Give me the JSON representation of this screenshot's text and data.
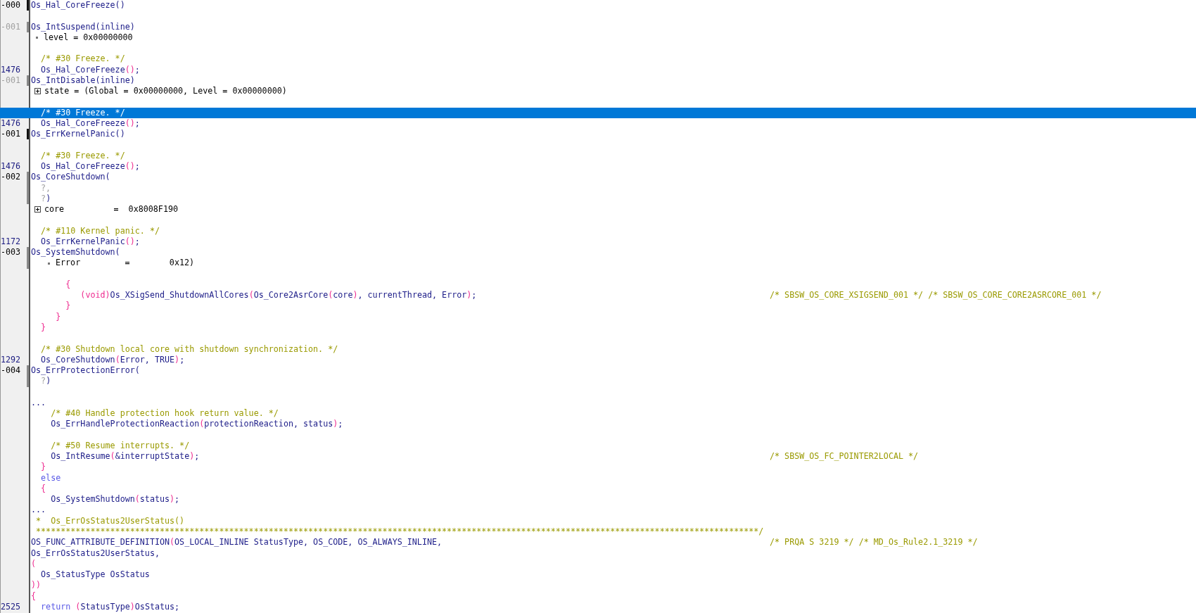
{
  "lines": [
    {
      "selected": false,
      "num": {
        "text": "-000",
        "kind": "frame"
      },
      "marker": {
        "current": true
      },
      "parts": [
        {
          "kind": "fn",
          "text": "Os_Hal_CoreFreeze()"
        }
      ]
    },
    {
      "selected": false
    },
    {
      "selected": false,
      "num": {
        "text": "-001",
        "kind": "inline"
      },
      "marker": {
        "current": false
      },
      "parts": [
        {
          "kind": "fn",
          "text": "Os_IntSuspend(inline)"
        }
      ]
    },
    {
      "selected": false,
      "expander": {
        "kind": "dot",
        "nested": false
      },
      "parts": [
        {
          "kind": "plain",
          "text": "level = 0x00000000"
        }
      ]
    },
    {
      "selected": false
    },
    {
      "selected": false,
      "parts": [
        {
          "kind": "comment",
          "text": "  /* #30 Freeze. */"
        }
      ]
    },
    {
      "selected": false,
      "num": {
        "text": "1476",
        "kind": "source"
      },
      "parts": [
        {
          "kind": "fn",
          "text": "  Os_Hal_CoreFreeze"
        },
        {
          "kind": "punct",
          "text": "()"
        },
        {
          "kind": "fn",
          "text": ";"
        }
      ]
    },
    {
      "selected": false,
      "num": {
        "text": "-001",
        "kind": "inline"
      },
      "marker": {
        "current": false
      },
      "parts": [
        {
          "kind": "fn",
          "text": "Os_IntDisable(inline)"
        }
      ]
    },
    {
      "selected": false,
      "expander": {
        "kind": "plus",
        "nested": false
      },
      "parts": [
        {
          "kind": "plain",
          "text": "state = (Global = 0x00000000, Level = 0x00000000)"
        }
      ]
    },
    {
      "selected": false
    },
    {
      "selected": true,
      "parts": [
        {
          "kind": "comment",
          "text": "  /* #30 Freeze. */"
        }
      ]
    },
    {
      "selected": false,
      "num": {
        "text": "1476",
        "kind": "source"
      },
      "parts": [
        {
          "kind": "fn",
          "text": "  Os_Hal_CoreFreeze"
        },
        {
          "kind": "punct",
          "text": "()"
        },
        {
          "kind": "fn",
          "text": ";"
        }
      ]
    },
    {
      "selected": false,
      "num": {
        "text": "-001",
        "kind": "frame"
      },
      "marker": {
        "current": true
      },
      "parts": [
        {
          "kind": "fn",
          "text": "Os_ErrKernelPanic()"
        }
      ]
    },
    {
      "selected": false
    },
    {
      "selected": false,
      "parts": [
        {
          "kind": "comment",
          "text": "  /* #30 Freeze. */"
        }
      ]
    },
    {
      "selected": false,
      "num": {
        "text": "1476",
        "kind": "source"
      },
      "parts": [
        {
          "kind": "fn",
          "text": "  Os_Hal_CoreFreeze"
        },
        {
          "kind": "punct",
          "text": "()"
        },
        {
          "kind": "fn",
          "text": ";"
        }
      ]
    },
    {
      "selected": false,
      "num": {
        "text": "-002",
        "kind": "frame"
      },
      "marker": {
        "current": false
      },
      "parts": [
        {
          "kind": "fn",
          "text": "Os_CoreShutdown("
        }
      ]
    },
    {
      "selected": false,
      "marker": {
        "current": false
      },
      "parts": [
        {
          "kind": "unknown",
          "text": "  ?,"
        }
      ]
    },
    {
      "selected": false,
      "marker": {
        "current": false
      },
      "parts": [
        {
          "kind": "unknown",
          "text": "  ?"
        },
        {
          "kind": "fn",
          "text": ")"
        }
      ]
    },
    {
      "selected": false,
      "expander": {
        "kind": "plus",
        "nested": false
      },
      "parts": [
        {
          "kind": "plain",
          "text": "core          =  0x8008F190"
        }
      ]
    },
    {
      "selected": false
    },
    {
      "selected": false,
      "parts": [
        {
          "kind": "comment",
          "text": "  /* #110 Kernel panic. */"
        }
      ]
    },
    {
      "selected": false,
      "num": {
        "text": "1172",
        "kind": "source"
      },
      "parts": [
        {
          "kind": "fn",
          "text": "  Os_ErrKernelPanic"
        },
        {
          "kind": "punct",
          "text": "()"
        },
        {
          "kind": "fn",
          "text": ";"
        }
      ]
    },
    {
      "selected": false,
      "num": {
        "text": "-003",
        "kind": "frame"
      },
      "marker": {
        "current": false
      },
      "parts": [
        {
          "kind": "fn",
          "text": "Os_SystemShutdown("
        }
      ]
    },
    {
      "selected": false,
      "marker": {
        "current": false
      },
      "expander": {
        "kind": "dot",
        "nested": true
      },
      "parts": [
        {
          "kind": "plain",
          "text": "Error         =        0x12)"
        }
      ]
    },
    {
      "selected": false
    },
    {
      "selected": false,
      "parts": [
        {
          "kind": "punct",
          "text": "       {"
        }
      ]
    },
    {
      "selected": false,
      "parts": [
        {
          "kind": "punct",
          "text": "          (void)"
        },
        {
          "kind": "fn",
          "text": "Os_XSigSend_ShutdownAllCores"
        },
        {
          "kind": "punct",
          "text": "("
        },
        {
          "kind": "fn",
          "text": "Os_Core2AsrCore"
        },
        {
          "kind": "punct",
          "text": "("
        },
        {
          "kind": "fn",
          "text": "core"
        },
        {
          "kind": "punct",
          "text": ")"
        },
        {
          "kind": "fn",
          "text": ", currentThread, Error"
        },
        {
          "kind": "punct",
          "text": ")"
        },
        {
          "kind": "fn",
          "text": ";"
        }
      ],
      "trail": "/* SBSW_OS_CORE_XSIGSEND_001 */ /* SBSW_OS_CORE_CORE2ASRCORE_001 */"
    },
    {
      "selected": false,
      "parts": [
        {
          "kind": "punct",
          "text": "       }"
        }
      ]
    },
    {
      "selected": false,
      "parts": [
        {
          "kind": "punct",
          "text": "     }"
        }
      ]
    },
    {
      "selected": false,
      "parts": [
        {
          "kind": "punct",
          "text": "  }"
        }
      ]
    },
    {
      "selected": false
    },
    {
      "selected": false,
      "parts": [
        {
          "kind": "comment",
          "text": "  /* #30 Shutdown local core with shutdown synchronization. */"
        }
      ]
    },
    {
      "selected": false,
      "num": {
        "text": "1292",
        "kind": "source"
      },
      "parts": [
        {
          "kind": "fn",
          "text": "  Os_CoreShutdown"
        },
        {
          "kind": "punct",
          "text": "("
        },
        {
          "kind": "fn",
          "text": "Error, TRUE"
        },
        {
          "kind": "punct",
          "text": ")"
        },
        {
          "kind": "fn",
          "text": ";"
        }
      ]
    },
    {
      "selected": false,
      "num": {
        "text": "-004",
        "kind": "frame"
      },
      "marker": {
        "current": false
      },
      "parts": [
        {
          "kind": "fn",
          "text": "Os_ErrProtectionError("
        }
      ]
    },
    {
      "selected": false,
      "marker": {
        "current": false
      },
      "parts": [
        {
          "kind": "unknown",
          "text": "  ?"
        },
        {
          "kind": "fn",
          "text": ")"
        }
      ]
    },
    {
      "selected": false
    },
    {
      "selected": false,
      "parts": [
        {
          "kind": "fn",
          "text": "..."
        }
      ]
    },
    {
      "selected": false,
      "parts": [
        {
          "kind": "comment",
          "text": "    /* #40 Handle protection hook return value. */"
        }
      ]
    },
    {
      "selected": false,
      "parts": [
        {
          "kind": "fn",
          "text": "    Os_ErrHandleProtectionReaction"
        },
        {
          "kind": "punct",
          "text": "("
        },
        {
          "kind": "fn",
          "text": "protectionReaction, status"
        },
        {
          "kind": "punct",
          "text": ")"
        },
        {
          "kind": "fn",
          "text": ";"
        }
      ]
    },
    {
      "selected": false
    },
    {
      "selected": false,
      "parts": [
        {
          "kind": "comment",
          "text": "    /* #50 Resume interrupts. */"
        }
      ]
    },
    {
      "selected": false,
      "parts": [
        {
          "kind": "fn",
          "text": "    Os_IntResume"
        },
        {
          "kind": "punct",
          "text": "("
        },
        {
          "kind": "fn",
          "text": "&interruptState"
        },
        {
          "kind": "punct",
          "text": ")"
        },
        {
          "kind": "fn",
          "text": ";"
        }
      ],
      "trail": "/* SBSW_OS_FC_POINTER2LOCAL */"
    },
    {
      "selected": false,
      "parts": [
        {
          "kind": "punct",
          "text": "  }"
        }
      ]
    },
    {
      "selected": false,
      "parts": [
        {
          "kind": "keyword",
          "text": "  else"
        }
      ]
    },
    {
      "selected": false,
      "parts": [
        {
          "kind": "punct",
          "text": "  {"
        }
      ]
    },
    {
      "selected": false,
      "parts": [
        {
          "kind": "fn",
          "text": "    Os_SystemShutdown"
        },
        {
          "kind": "punct",
          "text": "("
        },
        {
          "kind": "fn",
          "text": "status"
        },
        {
          "kind": "punct",
          "text": ")"
        },
        {
          "kind": "fn",
          "text": ";"
        }
      ]
    },
    {
      "selected": false,
      "parts": [
        {
          "kind": "fn",
          "text": "..."
        }
      ]
    },
    {
      "selected": false,
      "parts": [
        {
          "kind": "comment",
          "text": " *  Os_ErrOsStatus2UserStatus()"
        }
      ]
    },
    {
      "selected": false,
      "parts": [
        {
          "kind": "comment",
          "text": " **************************************************************************************************************************************************/"
        }
      ]
    },
    {
      "selected": false,
      "parts": [
        {
          "kind": "fn",
          "text": "OS_FUNC_ATTRIBUTE_DEFINITION"
        },
        {
          "kind": "punct",
          "text": "("
        },
        {
          "kind": "fn",
          "text": "OS_LOCAL_INLINE StatusType, OS_CODE, OS_ALWAYS_INLINE,"
        }
      ],
      "trail": "/* PRQA S 3219 */ /* MD_Os_Rule2.1_3219 */"
    },
    {
      "selected": false,
      "parts": [
        {
          "kind": "fn",
          "text": "Os_ErrOsStatus2UserStatus,"
        }
      ]
    },
    {
      "selected": false,
      "parts": [
        {
          "kind": "punct",
          "text": "("
        }
      ]
    },
    {
      "selected": false,
      "parts": [
        {
          "kind": "fn",
          "text": "  Os_StatusType OsStatus"
        }
      ]
    },
    {
      "selected": false,
      "parts": [
        {
          "kind": "punct",
          "text": "))"
        }
      ]
    },
    {
      "selected": false,
      "parts": [
        {
          "kind": "punct",
          "text": "{"
        }
      ]
    },
    {
      "selected": false,
      "num": {
        "text": "2525",
        "kind": "source"
      },
      "parts": [
        {
          "kind": "keyword",
          "text": "  return "
        },
        {
          "kind": "punct",
          "text": "("
        },
        {
          "kind": "fn",
          "text": "StatusType"
        },
        {
          "kind": "punct",
          "text": ")"
        },
        {
          "kind": "fn",
          "text": "OsStatus;"
        }
      ]
    }
  ]
}
